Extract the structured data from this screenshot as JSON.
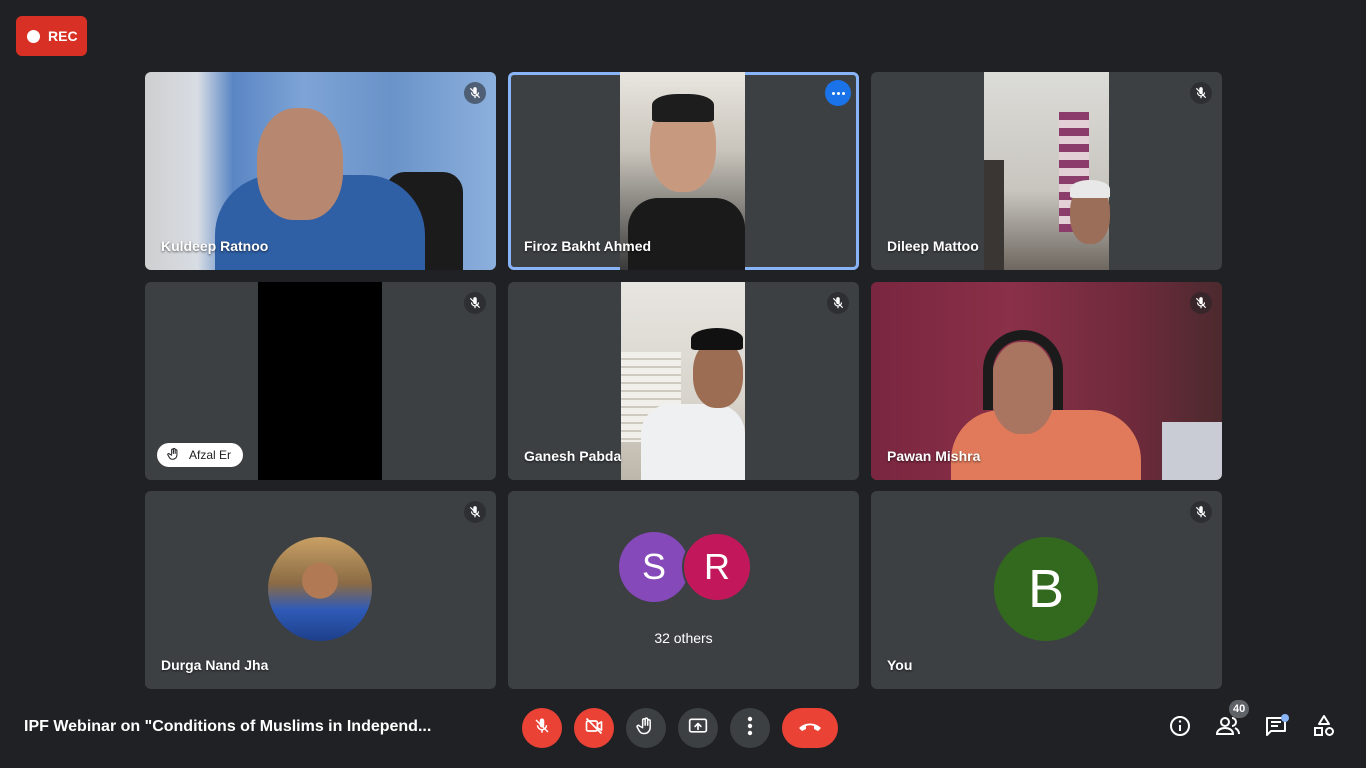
{
  "recording": {
    "label": "REC"
  },
  "participants": [
    {
      "name": "Kuldeep Ratnoo"
    },
    {
      "name": "Firoz Bakht Ahmed"
    },
    {
      "name": "Dileep Mattoo"
    },
    {
      "name": "Afzal Er",
      "hand_raised": true
    },
    {
      "name": "Ganesh Pabda"
    },
    {
      "name": "Pawan Mishra"
    },
    {
      "name": "Durga Nand Jha"
    },
    {
      "name": "You",
      "avatar_letter": "B"
    }
  ],
  "others_tile": {
    "avatars": [
      "S",
      "R"
    ],
    "label": "32 others"
  },
  "meeting": {
    "title": "IPF Webinar on \"Conditions of Muslims in Independ..."
  },
  "people_count": "40",
  "colors": {
    "background": "#202124",
    "tile": "#3c4043",
    "accent_red": "#ea4335",
    "active_border": "#8ab4f8",
    "rec": "#d93025"
  },
  "icons": {
    "tile_muted": "mic-off-icon",
    "tile_more": "more-options-icon",
    "hand": "raised-hand-icon",
    "controls": [
      "mic-off-icon",
      "camera-off-icon",
      "raise-hand-icon",
      "present-screen-icon",
      "more-vert-icon",
      "end-call-icon"
    ],
    "right": [
      "info-icon",
      "people-icon",
      "chat-icon",
      "activities-icon"
    ]
  }
}
